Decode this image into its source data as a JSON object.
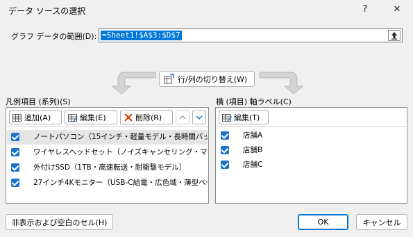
{
  "window": {
    "title": "データ ソースの選択",
    "help_icon": "?",
    "close_icon": "✕"
  },
  "range": {
    "label": "グラフ データの範囲(D):",
    "value": "=Sheet1!$A$3:$D$7"
  },
  "switch_button": {
    "label": "行/列の切り替え(W)"
  },
  "legend_panel": {
    "heading": "凡例項目 (系列)(S)",
    "toolbar": {
      "add_label": "追加(A)",
      "edit_label": "編集(E)",
      "delete_label": "削除(R)"
    },
    "items": [
      {
        "label": "ノートパソコン（15インチ・軽量モデル・長時間バッテリー",
        "checked": true,
        "selected": true
      },
      {
        "label": "ワイヤレスヘッドセット（ノイズキャンセリング・マイク付き）",
        "checked": true,
        "selected": false
      },
      {
        "label": "外付けSSD（1TB・高速転送・耐衝撃モデル）",
        "checked": true,
        "selected": false
      },
      {
        "label": "27インチ4Kモニター（USB-C給電・広色域・薄型ベゼ",
        "checked": true,
        "selected": false
      }
    ]
  },
  "axis_panel": {
    "heading": "横 (項目) 軸ラベル(C)",
    "toolbar": {
      "edit_label": "編集(T)"
    },
    "items": [
      {
        "label": "店舗A",
        "checked": true
      },
      {
        "label": "店舗B",
        "checked": true
      },
      {
        "label": "店舗C",
        "checked": true
      }
    ]
  },
  "footer": {
    "hidden_cells_label": "非表示および空白のセル(H)",
    "ok_label": "OK",
    "cancel_label": "キャンセル"
  },
  "colors": {
    "accent": "#0078d7",
    "checkbox": "#1a73c8",
    "delete_icon": "#d83b01"
  }
}
